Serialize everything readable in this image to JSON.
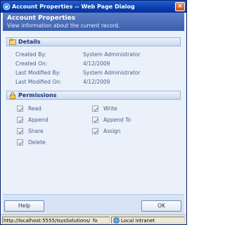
{
  "window": {
    "title": "Account Properties -- Web Page Dialog",
    "close_glyph": "×"
  },
  "header": {
    "title": "Account Properties",
    "subtitle": "View information about the current record."
  },
  "details": {
    "title": "Details",
    "rows": [
      {
        "label": "Created By:",
        "value": "System Administrator"
      },
      {
        "label": "Created On:",
        "value": "4/12/2009"
      },
      {
        "label": "Last Modified By:",
        "value": "System Administrator"
      },
      {
        "label": "Last Modified On:",
        "value": "4/12/2009"
      }
    ]
  },
  "permissions": {
    "title": "Permissions",
    "items": [
      {
        "label": "Read",
        "checked": true
      },
      {
        "label": "Write",
        "checked": true
      },
      {
        "label": "Append",
        "checked": true
      },
      {
        "label": "Append To",
        "checked": true
      },
      {
        "label": "Share",
        "checked": true
      },
      {
        "label": "Assign",
        "checked": true
      },
      {
        "label": "Delete",
        "checked": true
      }
    ]
  },
  "footer": {
    "help_label": "Help",
    "ok_label": "OK"
  },
  "statusbar": {
    "url": "http://localhost:5555/IsysSolutions/_fo",
    "zone": "Local intranet"
  },
  "icons": {
    "window_icon": "ie-icon",
    "details_icon": "details-icon",
    "permissions_icon": "lock-icon",
    "zone_icon": "globe-icon"
  }
}
